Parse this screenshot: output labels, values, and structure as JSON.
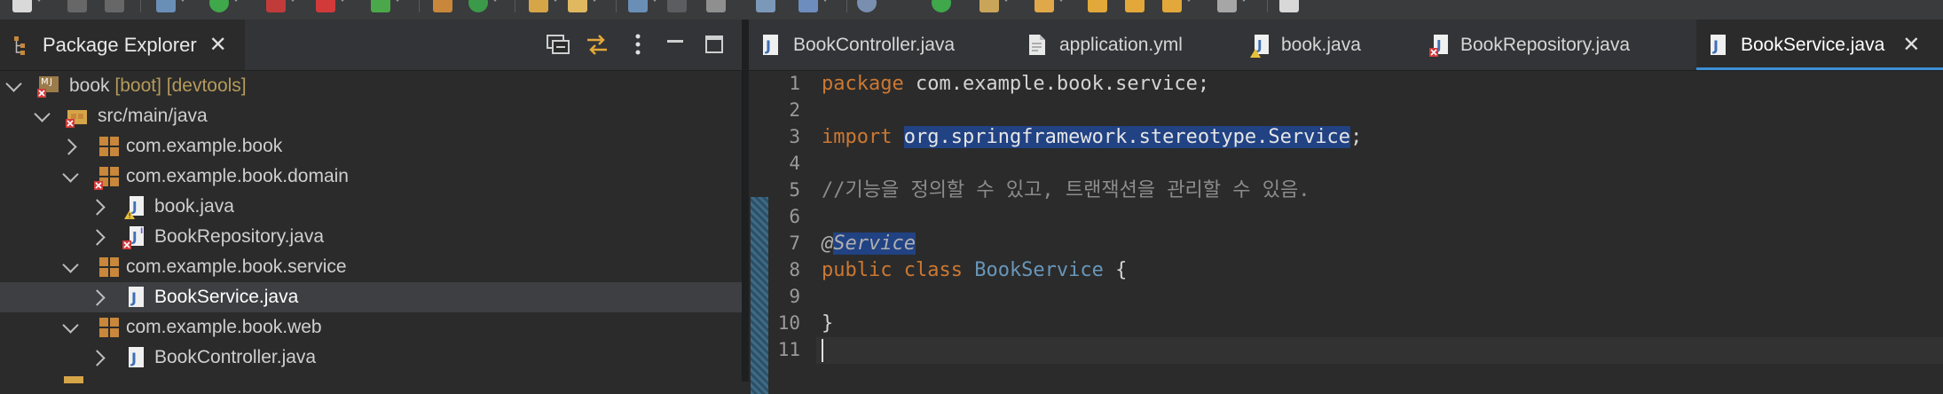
{
  "explorer": {
    "title": "Package Explorer",
    "close_glyph": "✕",
    "tree": [
      {
        "label": "book",
        "decoration": " [boot] [devtools]",
        "level": 0,
        "expanded": true,
        "icon": "maven-project-error-icon"
      },
      {
        "label": "src/main/java",
        "level": 1,
        "expanded": true,
        "icon": "source-folder-error-icon"
      },
      {
        "label": "com.example.book",
        "level": 2,
        "expanded": false,
        "icon": "package-icon"
      },
      {
        "label": "com.example.book.domain",
        "level": 2,
        "expanded": true,
        "icon": "package-error-icon"
      },
      {
        "label": "book.java",
        "level": 3,
        "expanded": false,
        "icon": "java-file-warning-icon"
      },
      {
        "label": "BookRepository.java",
        "level": 3,
        "expanded": false,
        "icon": "java-interface-error-icon"
      },
      {
        "label": "com.example.book.service",
        "level": 2,
        "expanded": true,
        "icon": "package-icon"
      },
      {
        "label": "BookService.java",
        "level": 3,
        "expanded": false,
        "icon": "java-file-icon",
        "selected": true
      },
      {
        "label": "com.example.book.web",
        "level": 2,
        "expanded": true,
        "icon": "package-icon"
      },
      {
        "label": "BookController.java",
        "level": 3,
        "expanded": false,
        "icon": "java-file-icon"
      }
    ]
  },
  "editor": {
    "tabs": [
      {
        "label": "BookController.java",
        "icon": "java-file-icon"
      },
      {
        "label": "application.yml",
        "icon": "yaml-file-icon"
      },
      {
        "label": "book.java",
        "icon": "java-file-warning-icon"
      },
      {
        "label": "BookRepository.java",
        "icon": "java-file-error-icon"
      },
      {
        "label": "BookService.java",
        "icon": "java-file-icon",
        "active": true
      }
    ],
    "close_glyph": "✕",
    "line_numbers": [
      "1",
      "2",
      "3",
      "4",
      "5",
      "6",
      "7",
      "8",
      "9",
      "10",
      "11"
    ],
    "code": {
      "l1_kw": "package",
      "l1_rest": " com.example.book.service;",
      "l3_kw": "import",
      "l3_sel": "org.springframework.stereotype.Service",
      "l3_end": ";",
      "l5_comment": "//기능을 정의할 수 있고, 트랜잭션을 관리할 수 있음.",
      "l7_at": "@",
      "l7_ann": "Service",
      "l8_kw": "public class",
      "l8_cls": "BookService",
      "l8_brace": " {",
      "l10": "}"
    }
  },
  "colors": {
    "background": "#2b2b2b",
    "keyword": "#cc7832",
    "class_name": "#6897bb",
    "selection": "#214283",
    "active_tab_underline": "#3d8fd6"
  }
}
